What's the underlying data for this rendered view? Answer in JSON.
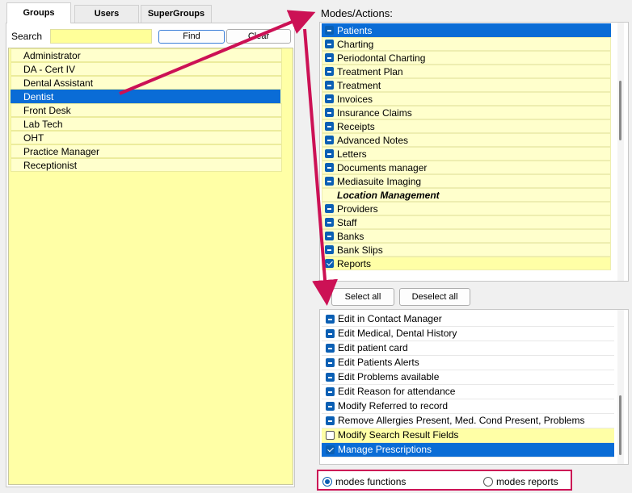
{
  "tabs": [
    {
      "label": "Groups",
      "active": true
    },
    {
      "label": "Users",
      "active": false
    },
    {
      "label": "SuperGroups",
      "active": false
    }
  ],
  "search": {
    "label": "Search",
    "value": "",
    "find_label": "Find",
    "clear_label": "Clear"
  },
  "groups": [
    "Administrator",
    "DA - Cert IV",
    "Dental Assistant",
    "Dentist",
    "Front Desk",
    "Lab Tech",
    "OHT",
    "Practice Manager",
    "Receptionist"
  ],
  "selected_group": "Dentist",
  "modes": {
    "label": "Modes/Actions:",
    "items": [
      {
        "label": "Patients",
        "state": "partial",
        "selected": true
      },
      {
        "label": "Charting",
        "state": "partial"
      },
      {
        "label": "Periodontal Charting",
        "state": "partial"
      },
      {
        "label": "Treatment Plan",
        "state": "partial"
      },
      {
        "label": "Treatment",
        "state": "partial"
      },
      {
        "label": "Invoices",
        "state": "partial"
      },
      {
        "label": "Insurance Claims",
        "state": "partial"
      },
      {
        "label": "Receipts",
        "state": "partial"
      },
      {
        "label": "Advanced Notes",
        "state": "partial"
      },
      {
        "label": "Letters",
        "state": "partial"
      },
      {
        "label": "Documents manager",
        "state": "partial"
      },
      {
        "label": "Mediasuite Imaging",
        "state": "partial"
      },
      {
        "label": "Location Management",
        "state": "category"
      },
      {
        "label": "Providers",
        "state": "partial"
      },
      {
        "label": "Staff",
        "state": "partial"
      },
      {
        "label": "Banks",
        "state": "partial"
      },
      {
        "label": "Bank Slips",
        "state": "partial"
      },
      {
        "label": "Reports",
        "state": "checked"
      }
    ]
  },
  "buttons": {
    "select_all": "Select all",
    "deselect_all": "Deselect all"
  },
  "functions": [
    {
      "label": "Edit in Contact Manager",
      "state": "partial"
    },
    {
      "label": "Edit Medical, Dental History",
      "state": "partial"
    },
    {
      "label": "Edit patient card",
      "state": "partial"
    },
    {
      "label": "Edit Patients Alerts",
      "state": "partial"
    },
    {
      "label": "Edit Problems available",
      "state": "partial"
    },
    {
      "label": "Edit Reason for attendance",
      "state": "partial"
    },
    {
      "label": "Modify Referred to record",
      "state": "partial"
    },
    {
      "label": "Remove Allergies Present, Med. Cond Present, Problems",
      "state": "partial"
    },
    {
      "label": "Modify Search Result Fields",
      "state": "empty"
    },
    {
      "label": "Manage Prescriptions",
      "state": "checked",
      "selected": true
    }
  ],
  "view_mode": {
    "options": [
      "modes functions",
      "modes reports"
    ],
    "selected": "modes functions"
  },
  "colors": {
    "selection": "#0a6cd6",
    "list_yellow": "#ffffa6",
    "annotation": "#cc1155"
  }
}
